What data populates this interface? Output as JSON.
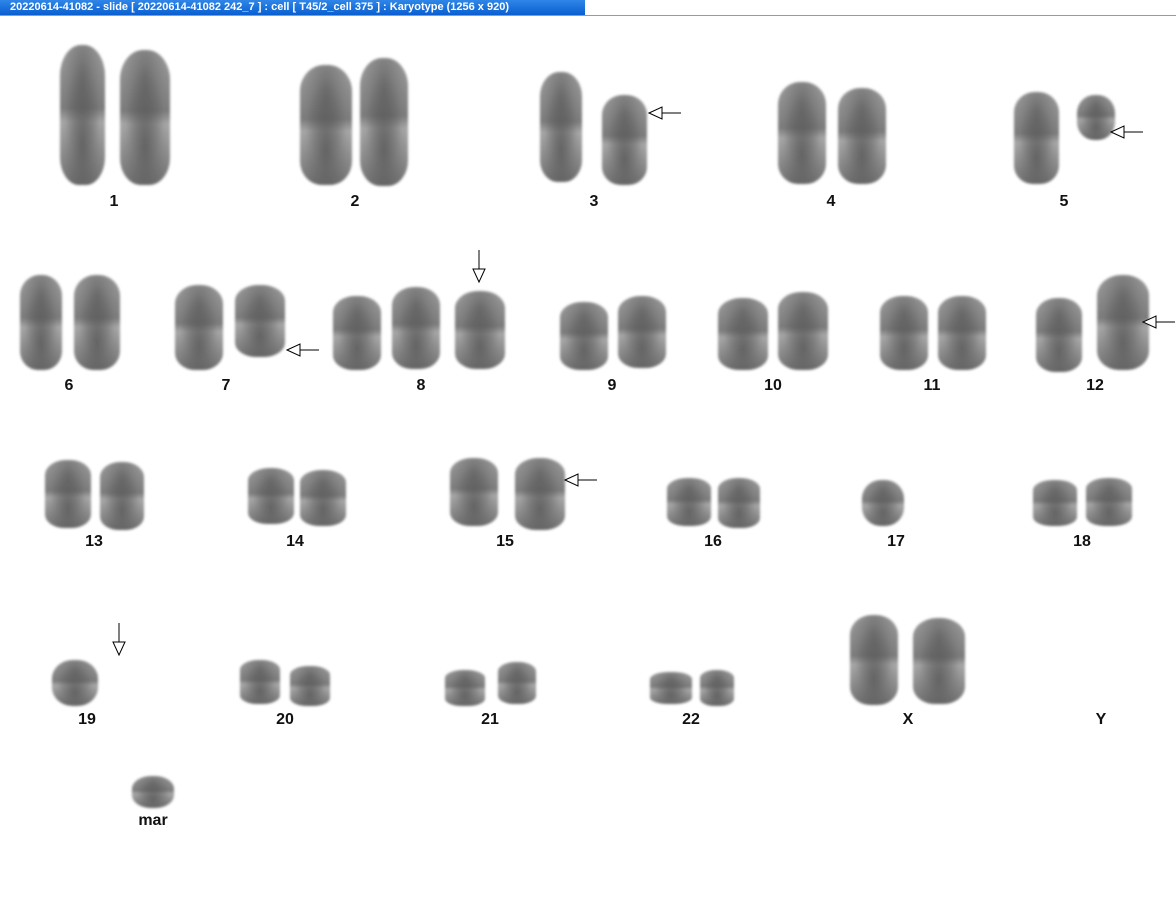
{
  "window": {
    "title": "20220614-41082 - slide [ 20220614-41082 242_7 ] : cell [ T45/2_cell 375 ] : Karyotype  (1256 x 920)"
  },
  "karyotype": {
    "labels": [
      "1",
      "2",
      "3",
      "4",
      "5",
      "6",
      "7",
      "8",
      "9",
      "10",
      "11",
      "12",
      "13",
      "14",
      "15",
      "16",
      "17",
      "18",
      "19",
      "20",
      "21",
      "22",
      "X",
      "Y",
      "mar"
    ],
    "arrow_icon": "open-arrowhead-pointer"
  }
}
